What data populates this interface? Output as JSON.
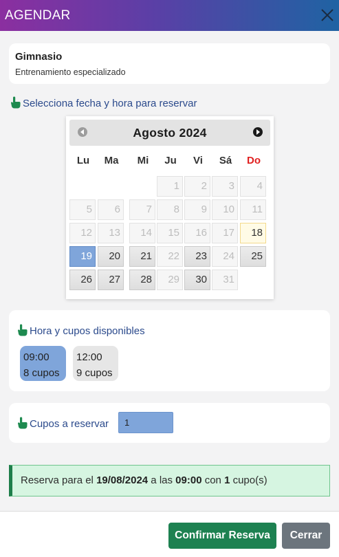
{
  "header": {
    "title": "AGENDAR",
    "close_icon": "close-icon"
  },
  "gym": {
    "name": "Gimnasio",
    "subtitle": "Entrenamiento especializado"
  },
  "select_hint": "Selecciona fecha y hora para reservar",
  "calendar": {
    "month_label": "Agosto 2024",
    "prev_icon": "chevron-left-circle-icon",
    "next_icon": "chevron-right-circle-icon",
    "weekdays": [
      "Lu",
      "Ma",
      "Mi",
      "Ju",
      "Vi",
      "Sá",
      "Do"
    ],
    "first_weekday_index": 3,
    "days": [
      {
        "d": "1",
        "state": "disabled"
      },
      {
        "d": "2",
        "state": "disabled"
      },
      {
        "d": "3",
        "state": "disabled"
      },
      {
        "d": "4",
        "state": "disabled"
      },
      {
        "d": "5",
        "state": "disabled"
      },
      {
        "d": "6",
        "state": "disabled"
      },
      {
        "d": "7",
        "state": "disabled"
      },
      {
        "d": "8",
        "state": "disabled"
      },
      {
        "d": "9",
        "state": "disabled"
      },
      {
        "d": "10",
        "state": "disabled"
      },
      {
        "d": "11",
        "state": "disabled"
      },
      {
        "d": "12",
        "state": "disabled"
      },
      {
        "d": "13",
        "state": "disabled"
      },
      {
        "d": "14",
        "state": "disabled"
      },
      {
        "d": "15",
        "state": "disabled"
      },
      {
        "d": "16",
        "state": "disabled"
      },
      {
        "d": "17",
        "state": "disabled"
      },
      {
        "d": "18",
        "state": "today"
      },
      {
        "d": "19",
        "state": "selected"
      },
      {
        "d": "20",
        "state": "available"
      },
      {
        "d": "21",
        "state": "available"
      },
      {
        "d": "22",
        "state": "disabled"
      },
      {
        "d": "23",
        "state": "available"
      },
      {
        "d": "24",
        "state": "disabled"
      },
      {
        "d": "25",
        "state": "available"
      },
      {
        "d": "26",
        "state": "available"
      },
      {
        "d": "27",
        "state": "available"
      },
      {
        "d": "28",
        "state": "available"
      },
      {
        "d": "29",
        "state": "disabled"
      },
      {
        "d": "30",
        "state": "available"
      },
      {
        "d": "31",
        "state": "disabled"
      }
    ]
  },
  "slots": {
    "title": "Hora y cupos disponibles",
    "items": [
      {
        "time": "09:00",
        "cupos": "8 cupos",
        "selected": true
      },
      {
        "time": "12:00",
        "cupos": "9 cupos",
        "selected": false
      }
    ]
  },
  "cupos": {
    "label": "Cupos a reservar",
    "value": "1"
  },
  "summary": {
    "prefix": "Reserva para el ",
    "date": "19/08/2024",
    "mid": " a las ",
    "time": "09:00",
    "mid2": " con ",
    "count": "1",
    "suffix": " cupo(s)"
  },
  "footer": {
    "confirm_label": "Confirmar Reserva",
    "close_label": "Cerrar"
  },
  "colors": {
    "header_gradient_start": "#8b2fa0",
    "header_gradient_end": "#1f63a3",
    "selected_blue": "#7fa5da",
    "confirm_green": "#1d8151",
    "close_gray": "#6c757d",
    "hint_text": "#2b4a8c",
    "hand_icon": "#1e8a4f"
  }
}
